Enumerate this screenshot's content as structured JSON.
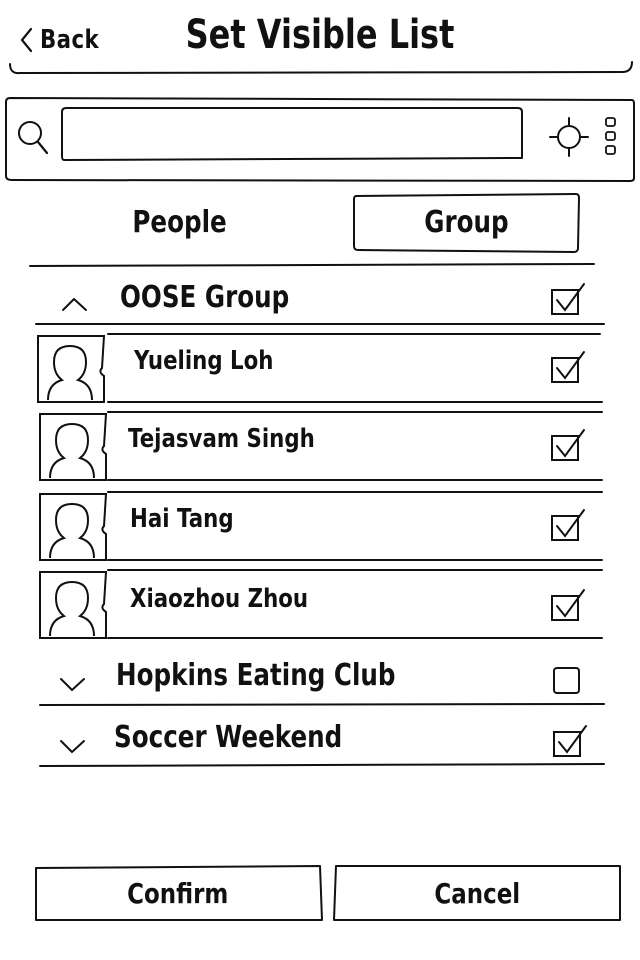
{
  "header": {
    "back_label": "Back",
    "title": "Set Visible List"
  },
  "search": {
    "value": "",
    "placeholder": ""
  },
  "tabs": [
    {
      "label": "People",
      "selected": false
    },
    {
      "label": "Group",
      "selected": true
    }
  ],
  "groups": [
    {
      "name": "OOSE Group",
      "expanded": true,
      "checked": true,
      "members": [
        {
          "name": "Yueling Loh",
          "checked": true
        },
        {
          "name": "Tejasvam Singh",
          "checked": true
        },
        {
          "name": "Hai Tang",
          "checked": true
        },
        {
          "name": "Xiaozhou Zhou",
          "checked": true
        }
      ]
    },
    {
      "name": "Hopkins Eating Club",
      "expanded": false,
      "checked": false
    },
    {
      "name": "Soccer Weekend",
      "expanded": false,
      "checked": true
    }
  ],
  "footer": {
    "confirm_label": "Confirm",
    "cancel_label": "Cancel"
  }
}
